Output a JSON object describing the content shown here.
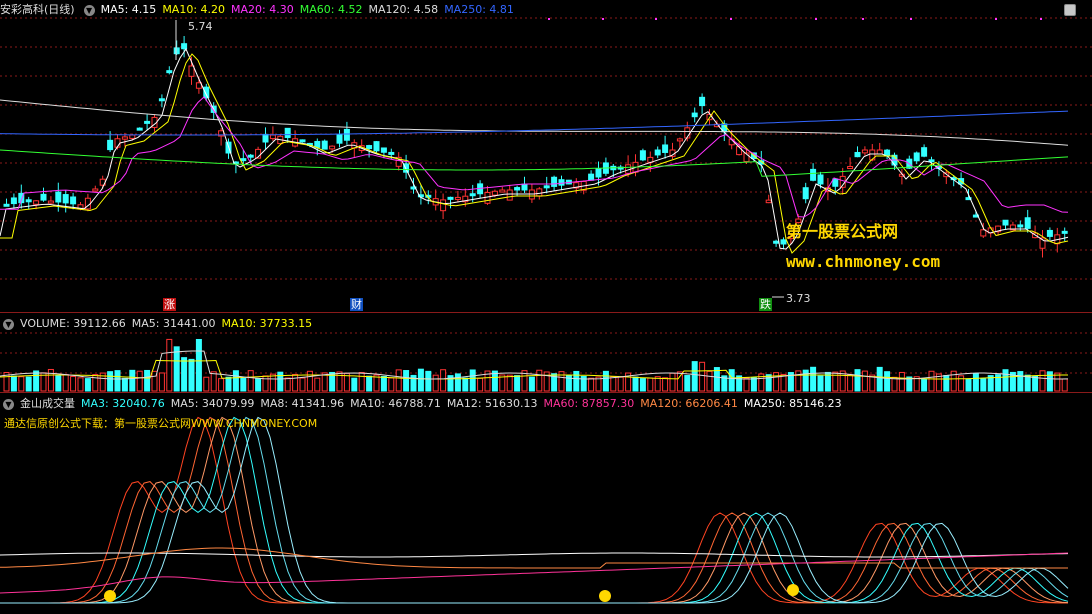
{
  "main_panel": {
    "stock_name": "安彩高科",
    "period": "(日线)",
    "indicators": [
      {
        "label": "MA5: 4.15",
        "color": "#ffffff"
      },
      {
        "label": "MA10: 4.20",
        "color": "#ffff00"
      },
      {
        "label": "MA20: 4.30",
        "color": "#ff33ff"
      },
      {
        "label": "MA60: 4.52",
        "color": "#33ff33"
      },
      {
        "label": "MA120: 4.58",
        "color": "#dddddd"
      },
      {
        "label": "MA250: 4.81",
        "color": "#3366ff"
      }
    ],
    "high_price": "5.74",
    "low_price": "3.73",
    "markers": [
      "涨",
      "财",
      "跌"
    ],
    "watermark_cn": "第一股票公式网",
    "watermark_url": "www.chnmoney.com"
  },
  "volume_panel": {
    "indicators": [
      {
        "label": "VOLUME: 39112.66",
        "color": "#dddddd"
      },
      {
        "label": "MA5: 31441.00",
        "color": "#dddddd"
      },
      {
        "label": "MA10: 37733.15",
        "color": "#ffff00"
      }
    ]
  },
  "jinshan_panel": {
    "title": "金山成交量",
    "indicators": [
      {
        "label": "MA3: 32040.76",
        "color": "#33ffff"
      },
      {
        "label": "MA5: 34079.99",
        "color": "#dddddd"
      },
      {
        "label": "MA8: 41341.96",
        "color": "#dddddd"
      },
      {
        "label": "MA10: 46788.71",
        "color": "#dddddd"
      },
      {
        "label": "MA12: 51630.13",
        "color": "#dddddd"
      },
      {
        "label": "MA60: 87857.30",
        "color": "#ff3399"
      },
      {
        "label": "MA120: 66206.41",
        "color": "#ff8844"
      },
      {
        "label": "MA250: 85146.23",
        "color": "#ffffff"
      }
    ],
    "note": "通达信原创公式下载：第一股票公式网WWW.CHNMONEY.COM"
  },
  "colors": {
    "up": "#ff3333",
    "down": "#33ffff",
    "grid": "#8a1a1a",
    "background": "#000000"
  }
}
